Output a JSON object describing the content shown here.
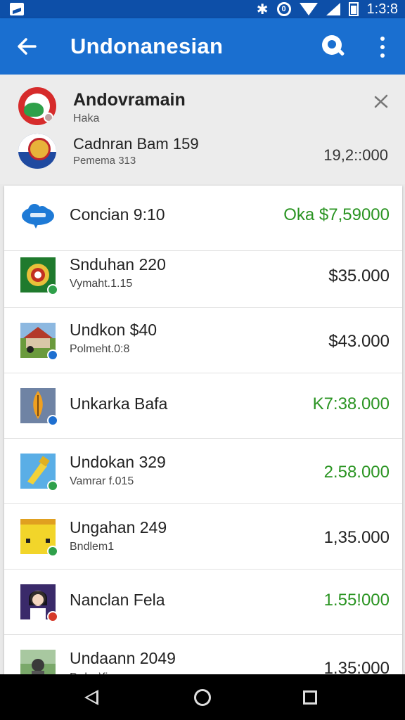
{
  "status_bar": {
    "time": "1:3:8",
    "icons": [
      "notification-icon",
      "bluetooth-icon",
      "sync-icon",
      "wifi-icon",
      "signal-icon",
      "battery-icon"
    ]
  },
  "app_bar": {
    "title": "Undonanesian",
    "background": "#1a6fd0",
    "icons": [
      "back-arrow-icon",
      "search-icon",
      "more-vert-icon"
    ]
  },
  "header": {
    "name": "Andovramain",
    "sub": "Haka",
    "account_name": "Cadnran Bam 159",
    "account_sub": "Pemema 313",
    "balance": "19,2::000"
  },
  "transactions": [
    {
      "title": "Concian 9:10",
      "sub": "",
      "amount": "Oka $7,59000",
      "green": true,
      "icon": "cloud-icon"
    },
    {
      "title": "Snduhan 220",
      "sub": "Vymaht.1.15",
      "amount": "$35.000",
      "green": false,
      "icon": "emblem-icon"
    },
    {
      "title": "Undkon $40",
      "sub": "Polmeht.0:8",
      "amount": "$43.000",
      "green": false,
      "icon": "house-icon"
    },
    {
      "title": "Unkarka Bafa",
      "sub": "",
      "amount": "K7:38.000",
      "green": true,
      "icon": "leaf-icon"
    },
    {
      "title": "Undokan 329",
      "sub": "Vamrar f.015",
      "amount": "2.58.000",
      "green": true,
      "icon": "tool-icon"
    },
    {
      "title": "Ungahan 249",
      "sub": "Bndlem1",
      "amount": "1,35.000",
      "green": false,
      "icon": "yellow-tile-icon"
    },
    {
      "title": "Nanclan Fela",
      "sub": "",
      "amount": "1.55!000",
      "green": true,
      "icon": "portrait-icon"
    },
    {
      "title": "Undaann 2049",
      "sub": "Prd_v\\fi",
      "amount": "1.35:000",
      "green": false,
      "icon": "landscape-icon"
    }
  ],
  "colors": {
    "accent": "#1a6fd0",
    "status_bar": "#0d4fa8",
    "positive": "#2a9422"
  },
  "nav_bar": {
    "icons": [
      "back-triangle-icon",
      "home-circle-icon",
      "recents-square-icon"
    ]
  }
}
